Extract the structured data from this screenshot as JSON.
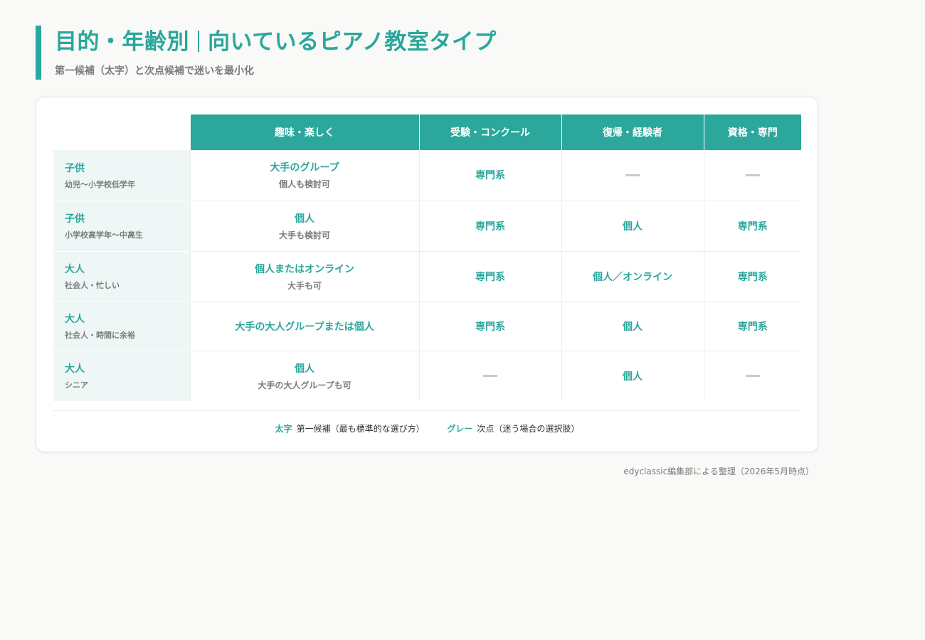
{
  "header": {
    "title_left": "目的・年齢別",
    "title_right": "向いているピアノ教室タイプ",
    "subtitle": "第一候補（太字）と次点候補で迷いを最小化"
  },
  "table": {
    "columns": [
      "趣味・楽しく",
      "受験・コンクール",
      "復帰・経験者",
      "資格・専門"
    ],
    "rows": [
      {
        "label": "子供",
        "sublabel": "幼児〜小学校低学年",
        "cells": [
          {
            "main": "大手のグループ",
            "sub": "個人も検討可"
          },
          {
            "main": "専門系",
            "sub": ""
          },
          {
            "main": "",
            "sub": "",
            "dash": true
          },
          {
            "main": "",
            "sub": "",
            "dash": true
          }
        ]
      },
      {
        "label": "子供",
        "sublabel": "小学校高学年〜中高生",
        "cells": [
          {
            "main": "個人",
            "sub": "大手も検討可"
          },
          {
            "main": "専門系",
            "sub": ""
          },
          {
            "main": "個人",
            "sub": ""
          },
          {
            "main": "専門系",
            "sub": ""
          }
        ]
      },
      {
        "label": "大人",
        "sublabel": "社会人・忙しい",
        "cells": [
          {
            "main": "個人またはオンライン",
            "sub": "大手も可"
          },
          {
            "main": "専門系",
            "sub": ""
          },
          {
            "main": "個人／オンライン",
            "sub": ""
          },
          {
            "main": "専門系",
            "sub": ""
          }
        ]
      },
      {
        "label": "大人",
        "sublabel": "社会人・時間に余裕",
        "cells": [
          {
            "main": "大手の大人グループまたは個人",
            "sub": ""
          },
          {
            "main": "専門系",
            "sub": ""
          },
          {
            "main": "個人",
            "sub": ""
          },
          {
            "main": "専門系",
            "sub": ""
          }
        ]
      },
      {
        "label": "大人",
        "sublabel": "シニア",
        "cells": [
          {
            "main": "個人",
            "sub": "大手の大人グループも可"
          },
          {
            "main": "",
            "sub": "",
            "dash": true
          },
          {
            "main": "個人",
            "sub": ""
          },
          {
            "main": "",
            "sub": "",
            "dash": true
          }
        ]
      }
    ]
  },
  "legend": {
    "bold_key": "太字",
    "bold_desc": "第一候補（最も標準的な選び方）",
    "gray_key": "グレー",
    "gray_desc": "次点（迷う場合の選択肢）"
  },
  "credit": "edyclassic編集部による整理（2026年5月時点）",
  "colors": {
    "accent": "#2ba79c",
    "row_head_bg": "#eef7f6",
    "muted": "#7b7b7b"
  }
}
